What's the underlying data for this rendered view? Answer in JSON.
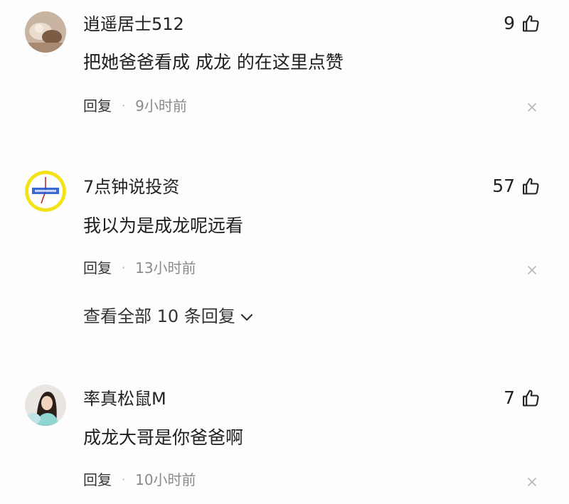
{
  "comments": [
    {
      "username": "逍遥居士512",
      "likes": "9",
      "text": "把她爸爸看成 成龙 的在这里点赞",
      "reply_label": "回复",
      "separator": "·",
      "time": "9小时前"
    },
    {
      "username": "7点钟说投资",
      "likes": "57",
      "text": "我以为是成龙呢远看",
      "reply_label": "回复",
      "separator": "·",
      "time": "13小时前",
      "view_all_replies": "查看全部 10 条回复"
    },
    {
      "username": "率真松鼠M",
      "likes": "7",
      "text": "成龙大哥是你爸爸啊",
      "reply_label": "回复",
      "separator": "·",
      "time": "10小时前"
    }
  ],
  "icons": {
    "like": "thumbs-up-icon",
    "close": "close-icon",
    "expand": "chevron-down-icon"
  }
}
